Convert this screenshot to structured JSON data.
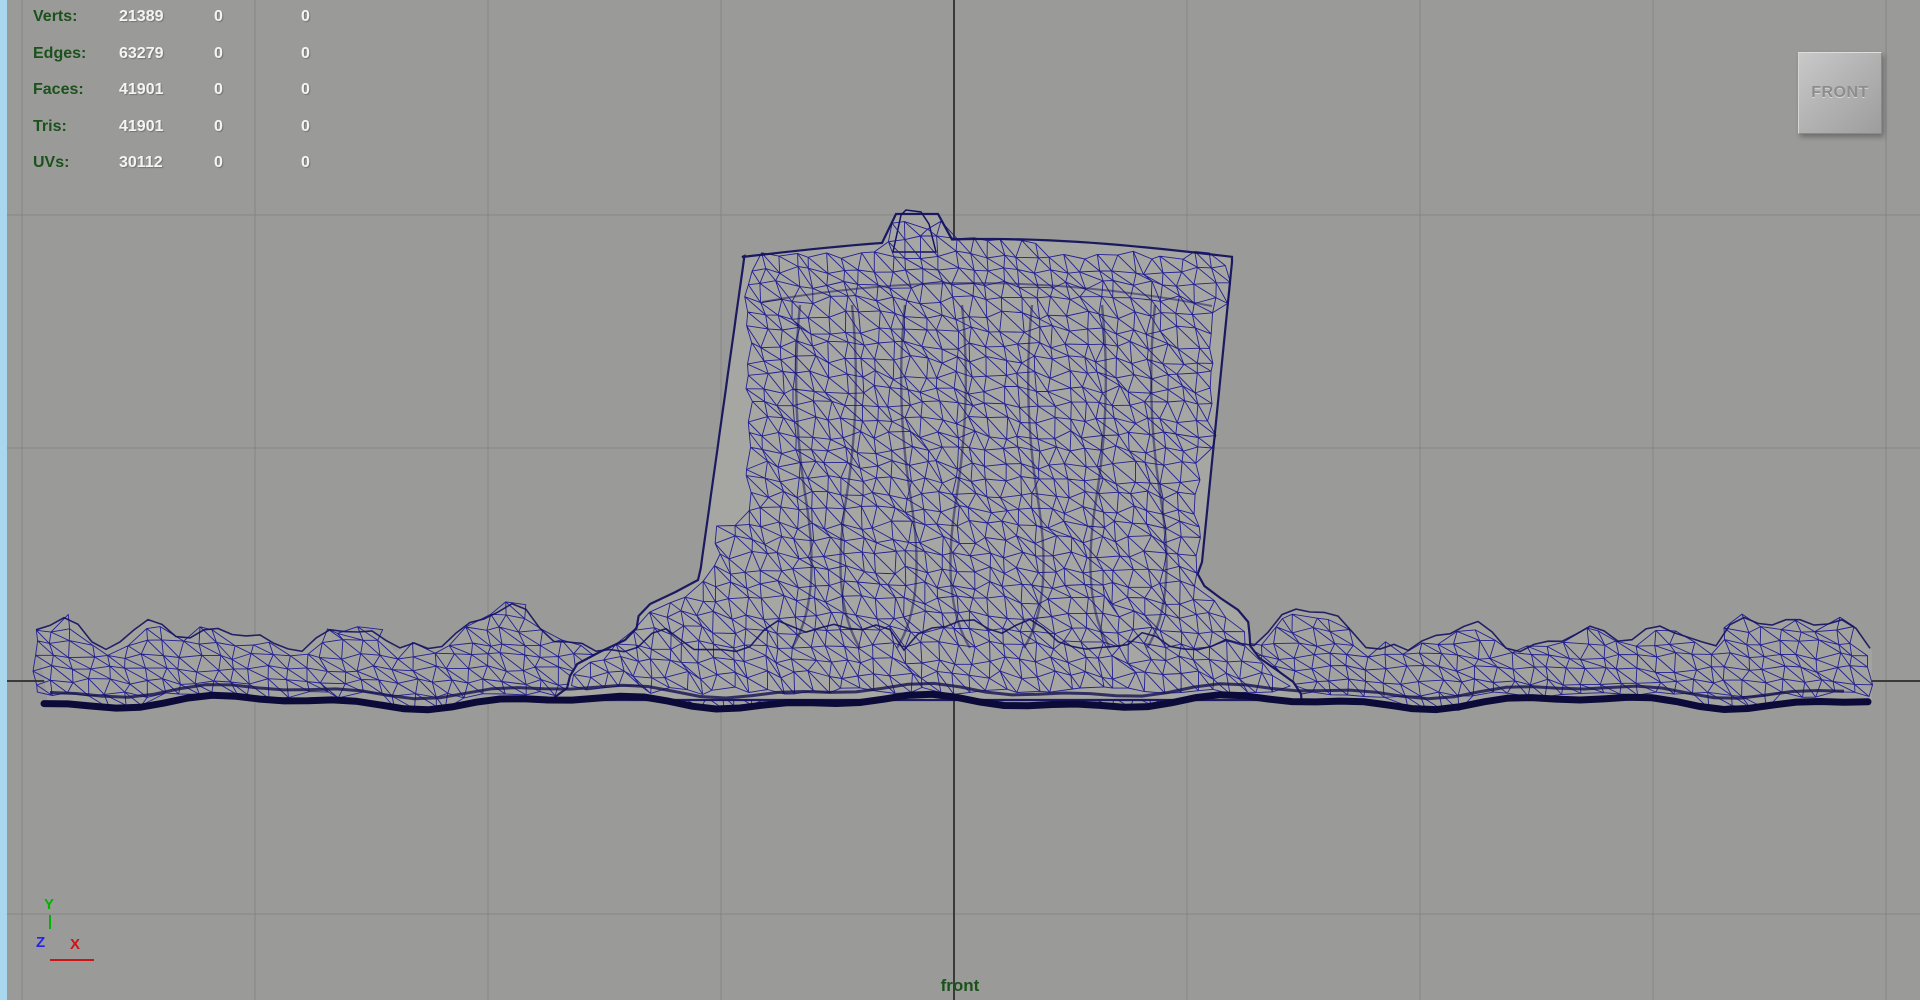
{
  "viewport": {
    "view_label": "front",
    "view_button": "FRONT",
    "bg_color": "#9a9b99",
    "grid_color": "#858585",
    "axis_line_color": "#3a3a3a",
    "wire_color": "#1b1890",
    "wire_dark": "#14125c",
    "wire_deep": "#0b0a38",
    "stump_fill": "#a6a6a3",
    "terrain_fill": "#a2a29f",
    "panel_border_color": "#a8d7ee"
  },
  "hud": {
    "label_color": "#1b511b",
    "value_color": "#f4f4f4",
    "rows": [
      {
        "label": "Verts:",
        "values": [
          "21389",
          "0",
          "0"
        ]
      },
      {
        "label": "Edges:",
        "values": [
          "63279",
          "0",
          "0"
        ]
      },
      {
        "label": "Faces:",
        "values": [
          "41901",
          "0",
          "0"
        ]
      },
      {
        "label": "Tris:",
        "values": [
          "41901",
          "0",
          "0"
        ]
      },
      {
        "label": "UVs:",
        "values": [
          "30112",
          "0",
          "0"
        ]
      }
    ]
  },
  "axis_gizmo": {
    "y_label": "Y",
    "z_label": "Z",
    "x_label": "X",
    "y_color": "#00b400",
    "x_color": "#cc1414",
    "z_color": "#2424e8"
  }
}
